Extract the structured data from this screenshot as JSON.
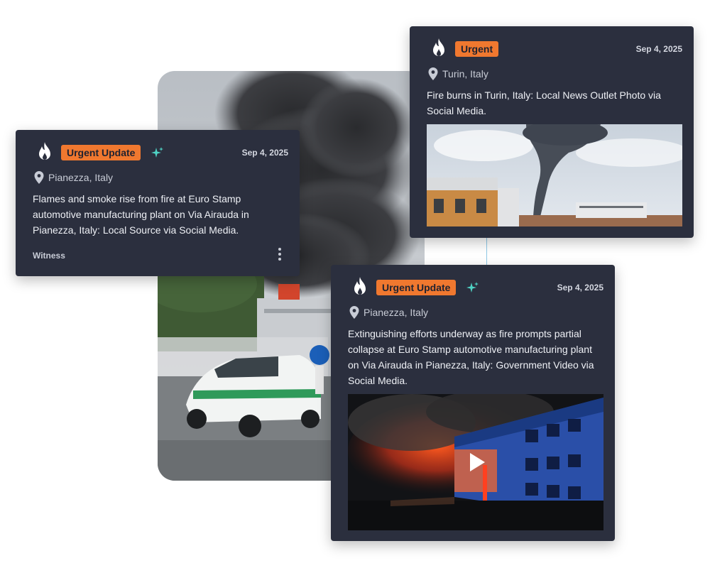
{
  "colors": {
    "card_bg": "#2b2f3e",
    "badge_bg": "#f0782f",
    "sparkle": "#4fd2c4",
    "connector": "#8fc9e6"
  },
  "cards": [
    {
      "badge": "Urgent Update",
      "has_sparkle": true,
      "icon": "flame-icon",
      "date": "Sep 4, 2025",
      "location": "Pianezza, Italy",
      "description": "Flames and smoke rise from fire at Euro Stamp automotive manufacturing plant on Via Airauda in Pianezza, Italy: Local Source via Social Media.",
      "source_label": "Witness",
      "menu_icon": "kebab-menu-icon"
    },
    {
      "badge": "Urgent",
      "has_sparkle": false,
      "icon": "flame-icon",
      "date": "Sep 4, 2025",
      "location": "Turin, Italy",
      "description": "Fire burns in Turin, Italy: Local News Outlet Photo via Social Media.",
      "media": "photo"
    },
    {
      "badge": "Urgent Update",
      "has_sparkle": true,
      "icon": "flame-icon",
      "date": "Sep 4, 2025",
      "location": "Pianezza, Italy",
      "description": "Extinguishing efforts underway as fire prompts partial collapse at Euro Stamp automotive manufacturing plant on Via Airauda in Pianezza, Italy: Government Video via Social Media.",
      "media": "video",
      "media_icon": "play-icon"
    }
  ]
}
